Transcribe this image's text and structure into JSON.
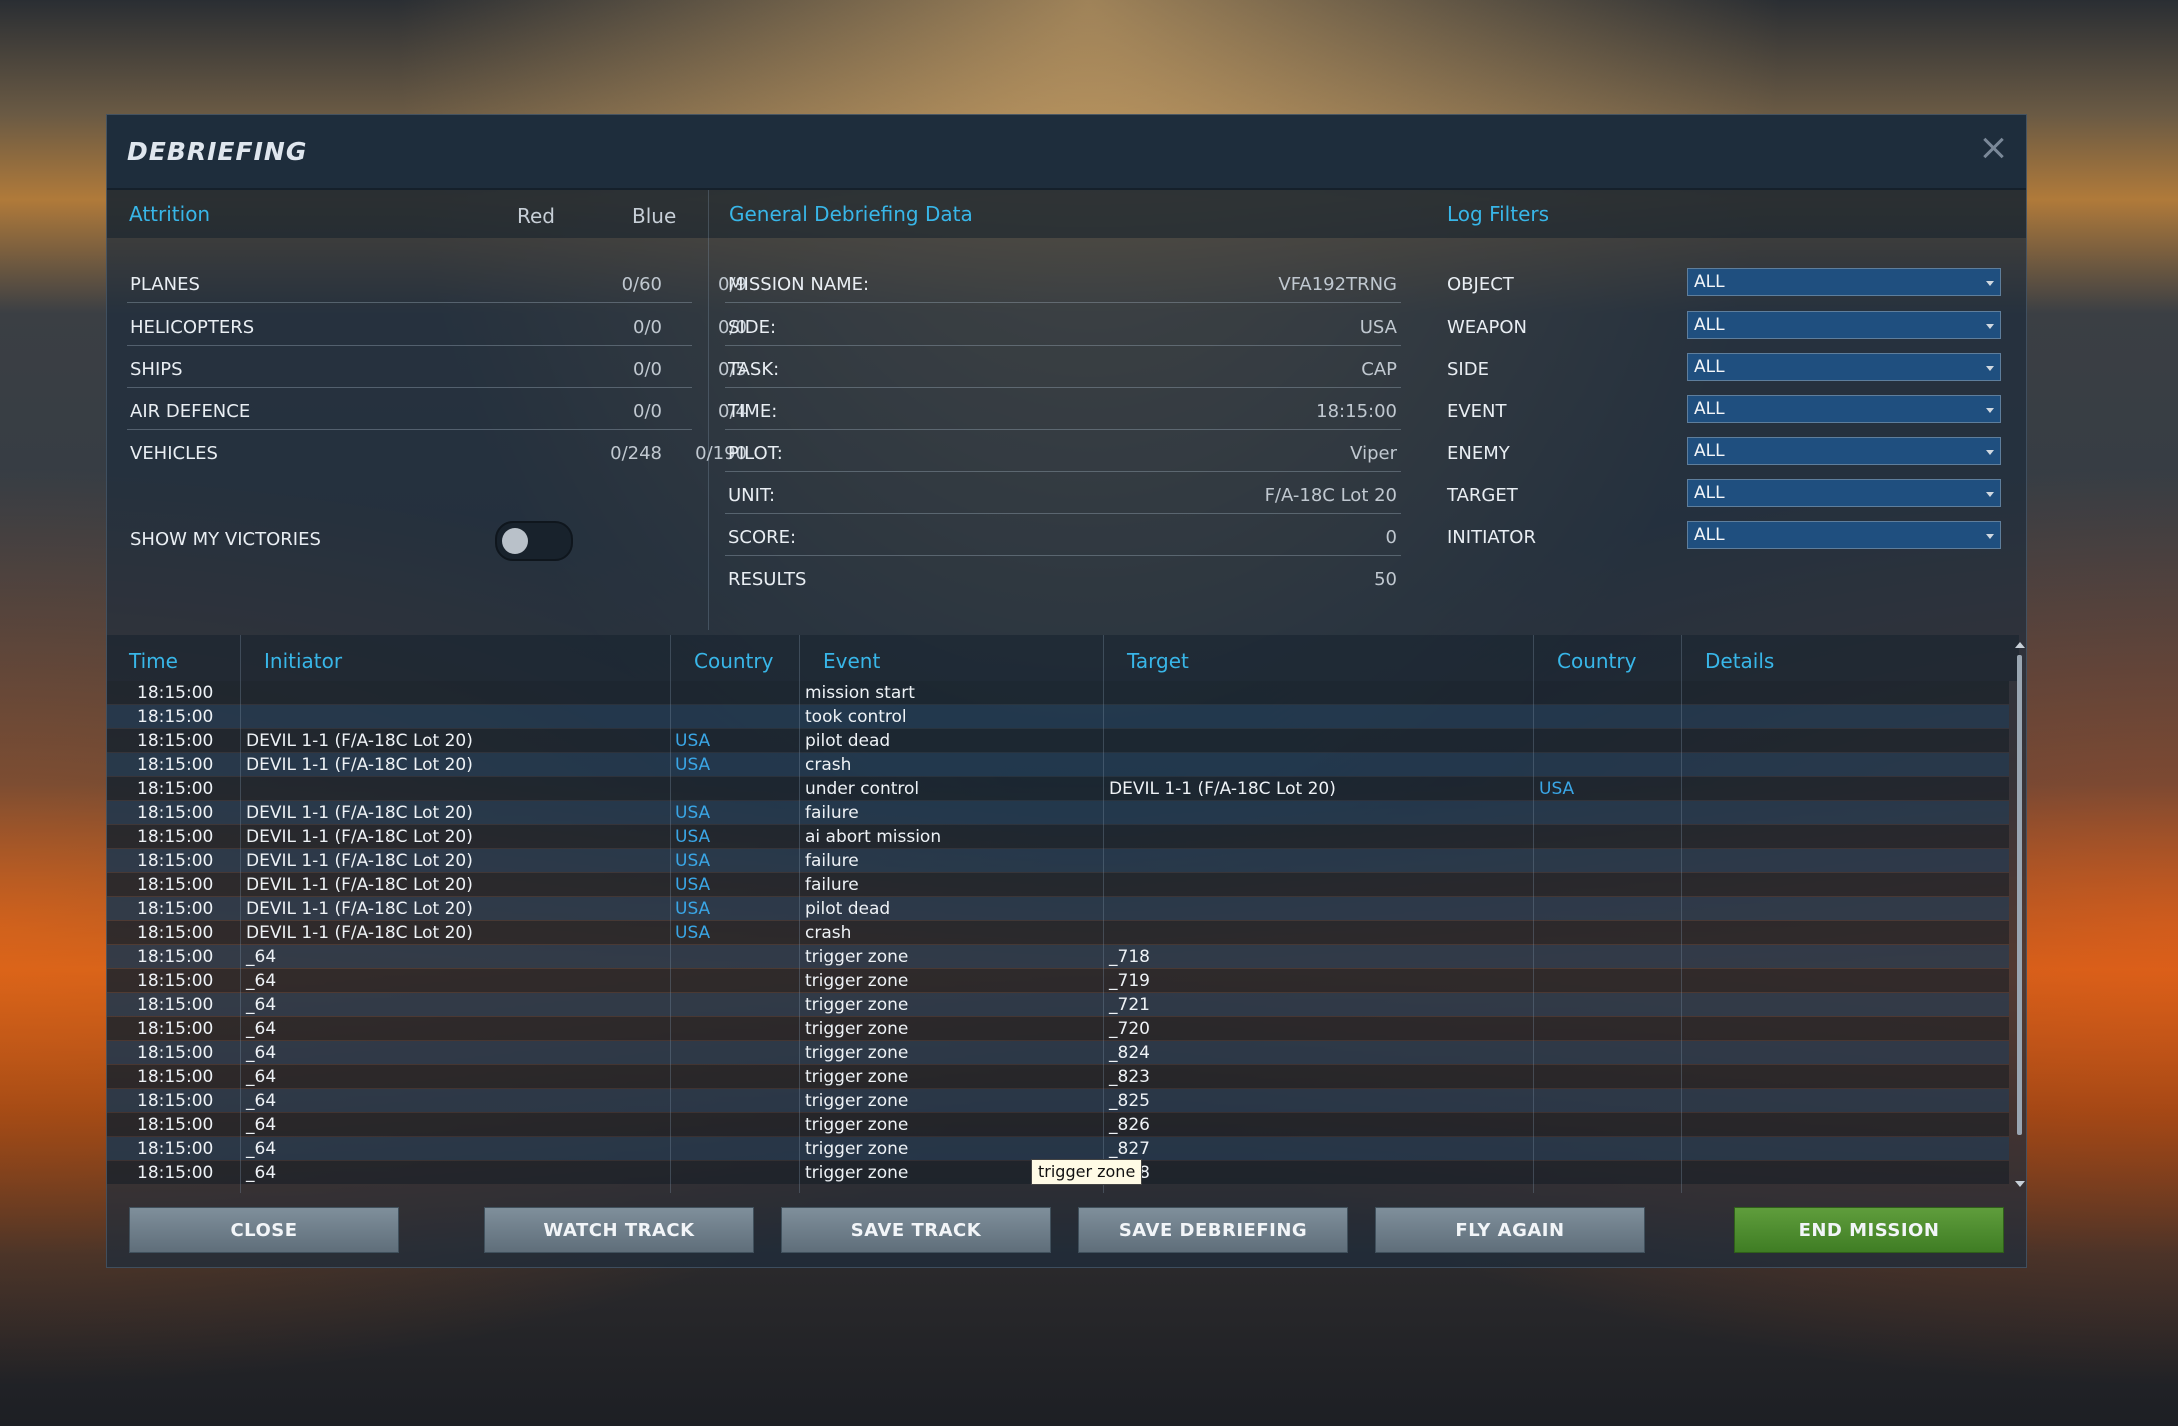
{
  "dialog": {
    "title": "DEBRIEFING"
  },
  "attrition": {
    "title": "Attrition",
    "col_red": "Red",
    "col_blue": "Blue",
    "rows": [
      {
        "label": "PLANES",
        "red": "0/60",
        "blue": "0/9"
      },
      {
        "label": "HELICOPTERS",
        "red": "0/0",
        "blue": "0/0"
      },
      {
        "label": "SHIPS",
        "red": "0/0",
        "blue": "0/5"
      },
      {
        "label": "AIR DEFENCE",
        "red": "0/0",
        "blue": "0/4"
      },
      {
        "label": "VEHICLES",
        "red": "0/248",
        "blue": "0/190"
      }
    ],
    "show_victories_label": "SHOW MY VICTORIES",
    "show_victories_on": false
  },
  "general": {
    "title": "General Debriefing Data",
    "rows": [
      {
        "label": "MISSION NAME:",
        "value": "VFA192TRNG"
      },
      {
        "label": "SIDE:",
        "value": "USA"
      },
      {
        "label": "TASK:",
        "value": "CAP"
      },
      {
        "label": "TIME:",
        "value": "18:15:00"
      },
      {
        "label": "PILOT:",
        "value": "Viper"
      },
      {
        "label": "UNIT:",
        "value": "F/A-18C Lot 20"
      },
      {
        "label": "SCORE:",
        "value": "0"
      },
      {
        "label": "RESULTS",
        "value": "50"
      }
    ]
  },
  "filters": {
    "title": "Log Filters",
    "rows": [
      {
        "label": "OBJECT",
        "value": "ALL"
      },
      {
        "label": "WEAPON",
        "value": "ALL"
      },
      {
        "label": "SIDE",
        "value": "ALL"
      },
      {
        "label": "EVENT",
        "value": "ALL"
      },
      {
        "label": "ENEMY",
        "value": "ALL"
      },
      {
        "label": "TARGET",
        "value": "ALL"
      },
      {
        "label": "INITIATOR",
        "value": "ALL"
      }
    ]
  },
  "log": {
    "headers": {
      "time": "Time",
      "initiator": "Initiator",
      "country": "Country",
      "event": "Event",
      "target": "Target",
      "target_country": "Country",
      "details": "Details"
    },
    "rows": [
      {
        "time": "18:15:00",
        "initiator": "",
        "country": "",
        "event": "mission start",
        "target": "",
        "tcountry": ""
      },
      {
        "time": "18:15:00",
        "initiator": "",
        "country": "",
        "event": "took control",
        "target": "",
        "tcountry": ""
      },
      {
        "time": "18:15:00",
        "initiator": "DEVIL 1-1 (F/A-18C Lot 20)",
        "country": "USA",
        "event": "pilot dead",
        "target": "",
        "tcountry": ""
      },
      {
        "time": "18:15:00",
        "initiator": "DEVIL 1-1 (F/A-18C Lot 20)",
        "country": "USA",
        "event": "crash",
        "target": "",
        "tcountry": ""
      },
      {
        "time": "18:15:00",
        "initiator": "",
        "country": "",
        "event": "under control",
        "target": "DEVIL 1-1 (F/A-18C Lot 20)",
        "tcountry": "USA"
      },
      {
        "time": "18:15:00",
        "initiator": "DEVIL 1-1 (F/A-18C Lot 20)",
        "country": "USA",
        "event": "failure",
        "target": "",
        "tcountry": ""
      },
      {
        "time": "18:15:00",
        "initiator": "DEVIL 1-1 (F/A-18C Lot 20)",
        "country": "USA",
        "event": "ai abort mission",
        "target": "",
        "tcountry": ""
      },
      {
        "time": "18:15:00",
        "initiator": "DEVIL 1-1 (F/A-18C Lot 20)",
        "country": "USA",
        "event": "failure",
        "target": "",
        "tcountry": ""
      },
      {
        "time": "18:15:00",
        "initiator": "DEVIL 1-1 (F/A-18C Lot 20)",
        "country": "USA",
        "event": "failure",
        "target": "",
        "tcountry": ""
      },
      {
        "time": "18:15:00",
        "initiator": "DEVIL 1-1 (F/A-18C Lot 20)",
        "country": "USA",
        "event": "pilot dead",
        "target": "",
        "tcountry": ""
      },
      {
        "time": "18:15:00",
        "initiator": "DEVIL 1-1 (F/A-18C Lot 20)",
        "country": "USA",
        "event": "crash",
        "target": "",
        "tcountry": ""
      },
      {
        "time": "18:15:00",
        "initiator": "_64",
        "country": "",
        "event": "trigger zone",
        "target": "_718",
        "tcountry": ""
      },
      {
        "time": "18:15:00",
        "initiator": "_64",
        "country": "",
        "event": "trigger zone",
        "target": "_719",
        "tcountry": ""
      },
      {
        "time": "18:15:00",
        "initiator": "_64",
        "country": "",
        "event": "trigger zone",
        "target": "_721",
        "tcountry": ""
      },
      {
        "time": "18:15:00",
        "initiator": "_64",
        "country": "",
        "event": "trigger zone",
        "target": "_720",
        "tcountry": ""
      },
      {
        "time": "18:15:00",
        "initiator": "_64",
        "country": "",
        "event": "trigger zone",
        "target": "_824",
        "tcountry": ""
      },
      {
        "time": "18:15:00",
        "initiator": "_64",
        "country": "",
        "event": "trigger zone",
        "target": "_823",
        "tcountry": ""
      },
      {
        "time": "18:15:00",
        "initiator": "_64",
        "country": "",
        "event": "trigger zone",
        "target": "_825",
        "tcountry": ""
      },
      {
        "time": "18:15:00",
        "initiator": "_64",
        "country": "",
        "event": "trigger zone",
        "target": "_826",
        "tcountry": ""
      },
      {
        "time": "18:15:00",
        "initiator": "_64",
        "country": "",
        "event": "trigger zone",
        "target": "_827",
        "tcountry": ""
      },
      {
        "time": "18:15:00",
        "initiator": "_64",
        "country": "",
        "event": "trigger zone",
        "target": "_828",
        "tcountry": ""
      }
    ],
    "tooltip": "trigger zone"
  },
  "buttons": {
    "close": "CLOSE",
    "watch_track": "WATCH TRACK",
    "save_track": "SAVE TRACK",
    "save_debriefing": "SAVE DEBRIEFING",
    "fly_again": "FLY AGAIN",
    "end_mission": "END MISSION"
  }
}
